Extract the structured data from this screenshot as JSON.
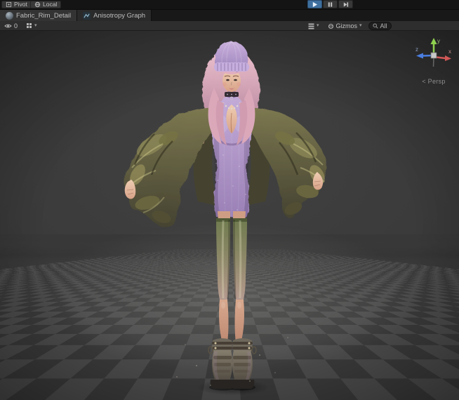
{
  "colors": {
    "topbar_bg": "#141414",
    "panel_bg": "#2e2e2e",
    "tab_active_bg": "#333333",
    "tab_bg": "#2a2a2a",
    "button_bg": "#383838",
    "play_active_bg": "#3e6f9e",
    "viewport_bg": "#3a3a3a",
    "text": "#c2c2c2",
    "checker_light": "#4e4e4e",
    "checker_dark": "#3c3c3c",
    "axis_x": "#d25757",
    "axis_y": "#8fd14f",
    "axis_z": "#4a7de0"
  },
  "top_toolbar": {
    "pivot_label": "Pivot",
    "local_label": "Local"
  },
  "tabs": [
    {
      "label": "Fabric_Rim_Detail"
    },
    {
      "label": "Anisotropy Graph"
    }
  ],
  "scene_toolbar": {
    "hidden_count": "0",
    "gizmos_label": "Gizmos",
    "search_value": "All"
  },
  "viewport": {
    "persp_label": "< Persp",
    "axis_labels": {
      "x": "x",
      "y": "y",
      "z": "z"
    }
  },
  "icons": {
    "dropdown_caret": "▾"
  }
}
